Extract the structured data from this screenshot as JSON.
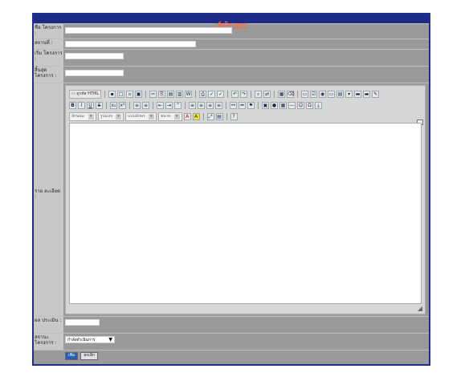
{
  "form": {
    "title": "เพิ่มโครงการ",
    "fields": {
      "project_name_label": "ชื่อ โครงการ :",
      "place_label": "สถานที่ :",
      "start_label": "เริ่ม โครงการ :",
      "end_label": "สิ้นสุด โครงการ :",
      "details_label": "ราย ละเอียด :",
      "evaluation_label": "ผล ประเมิน :",
      "status_label": "สถานะ โครงการ :"
    },
    "status_select": {
      "value": "กำลังดำเนินการ"
    },
    "buttons": {
      "save": "เพิ่ม",
      "cancel": "ยกเลิก"
    }
  },
  "editor": {
    "source_label": "ดูรหัส HTML",
    "combos": [
      {
        "label": "ลักษณะ"
      },
      {
        "label": "รูปแบบ"
      },
      {
        "label": "แบบอักษร"
      },
      {
        "label": "ขนาด"
      }
    ]
  }
}
